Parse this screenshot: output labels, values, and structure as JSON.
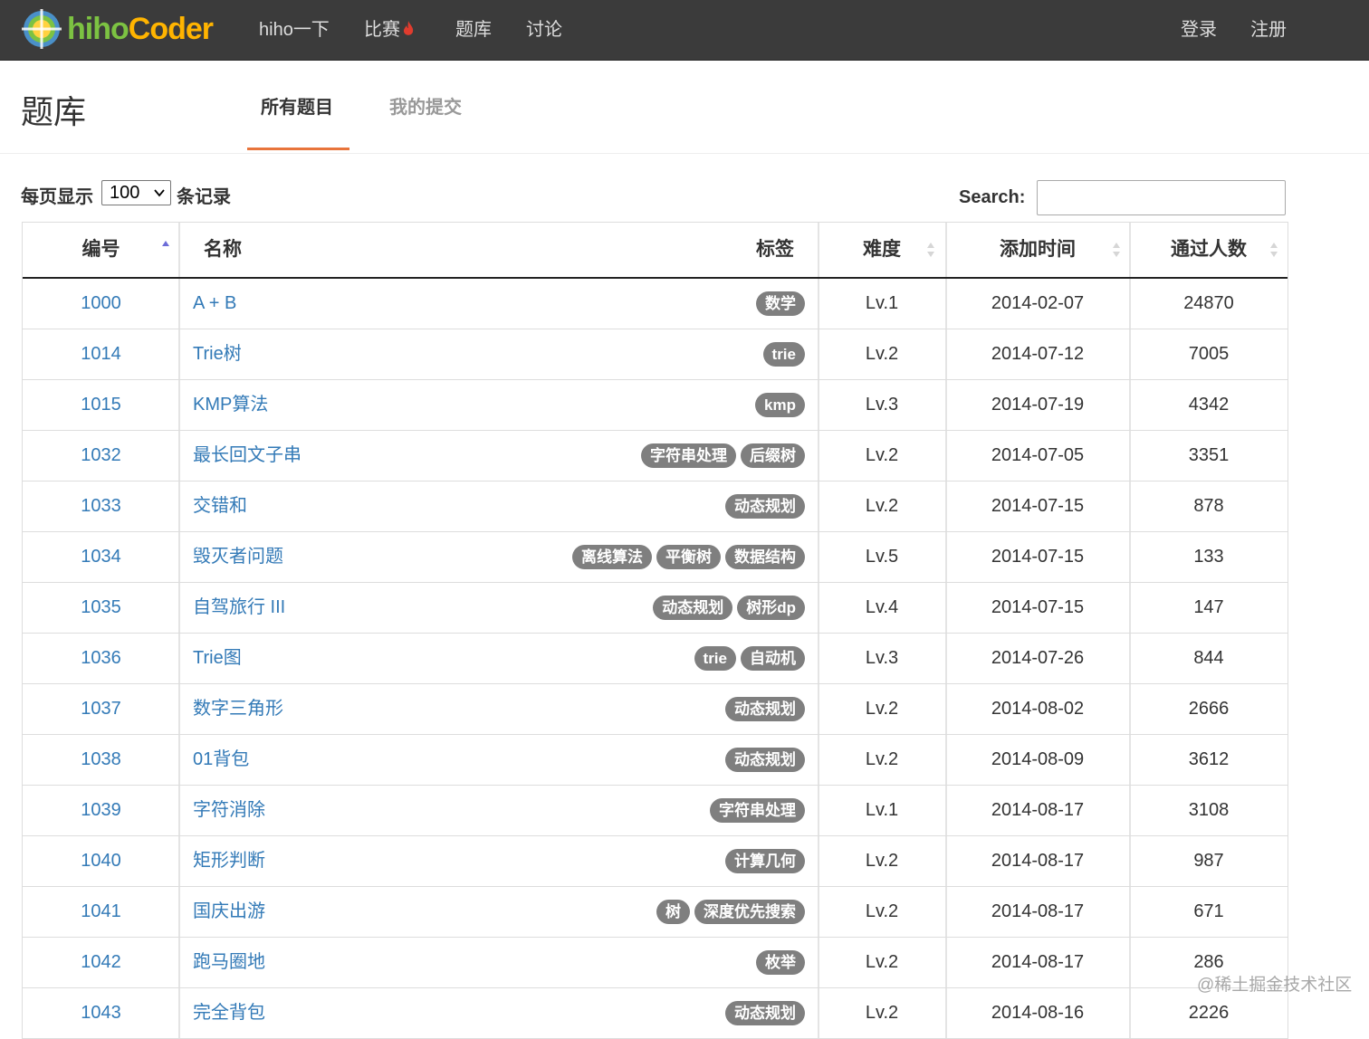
{
  "nav": {
    "logo_hiho": "hiho",
    "logo_coder": "Coder",
    "items": [
      "hiho一下",
      "比赛",
      "题库",
      "讨论"
    ],
    "login": "登录",
    "register": "注册"
  },
  "header": {
    "title": "题库",
    "tab_all": "所有题目",
    "tab_mine": "我的提交"
  },
  "controls": {
    "show_prefix": "每页显示",
    "page_size": "100",
    "show_suffix": "条记录",
    "search_label": "Search:",
    "search_value": ""
  },
  "table": {
    "headers": {
      "id": "编号",
      "name": "名称",
      "tags": "标签",
      "level": "难度",
      "date": "添加时间",
      "passed": "通过人数"
    },
    "rows": [
      {
        "id": "1000",
        "name": "A + B",
        "tags": [
          "数学"
        ],
        "level": "Lv.1",
        "date": "2014-02-07",
        "passed": "24870"
      },
      {
        "id": "1014",
        "name": "Trie树",
        "tags": [
          "trie"
        ],
        "level": "Lv.2",
        "date": "2014-07-12",
        "passed": "7005"
      },
      {
        "id": "1015",
        "name": "KMP算法",
        "tags": [
          "kmp"
        ],
        "level": "Lv.3",
        "date": "2014-07-19",
        "passed": "4342"
      },
      {
        "id": "1032",
        "name": "最长回文子串",
        "tags": [
          "字符串处理",
          "后缀树"
        ],
        "level": "Lv.2",
        "date": "2014-07-05",
        "passed": "3351"
      },
      {
        "id": "1033",
        "name": "交错和",
        "tags": [
          "动态规划"
        ],
        "level": "Lv.2",
        "date": "2014-07-15",
        "passed": "878"
      },
      {
        "id": "1034",
        "name": "毁灭者问题",
        "tags": [
          "离线算法",
          "平衡树",
          "数据结构"
        ],
        "level": "Lv.5",
        "date": "2014-07-15",
        "passed": "133"
      },
      {
        "id": "1035",
        "name": "自驾旅行 III",
        "tags": [
          "动态规划",
          "树形dp"
        ],
        "level": "Lv.4",
        "date": "2014-07-15",
        "passed": "147"
      },
      {
        "id": "1036",
        "name": "Trie图",
        "tags": [
          "trie",
          "自动机"
        ],
        "level": "Lv.3",
        "date": "2014-07-26",
        "passed": "844"
      },
      {
        "id": "1037",
        "name": "数字三角形",
        "tags": [
          "动态规划"
        ],
        "level": "Lv.2",
        "date": "2014-08-02",
        "passed": "2666"
      },
      {
        "id": "1038",
        "name": "01背包",
        "tags": [
          "动态规划"
        ],
        "level": "Lv.2",
        "date": "2014-08-09",
        "passed": "3612"
      },
      {
        "id": "1039",
        "name": "字符消除",
        "tags": [
          "字符串处理"
        ],
        "level": "Lv.1",
        "date": "2014-08-17",
        "passed": "3108"
      },
      {
        "id": "1040",
        "name": "矩形判断",
        "tags": [
          "计算几何"
        ],
        "level": "Lv.2",
        "date": "2014-08-17",
        "passed": "987"
      },
      {
        "id": "1041",
        "name": "国庆出游",
        "tags": [
          "树",
          "深度优先搜索"
        ],
        "level": "Lv.2",
        "date": "2014-08-17",
        "passed": "671"
      },
      {
        "id": "1042",
        "name": "跑马圈地",
        "tags": [
          "枚举"
        ],
        "level": "Lv.2",
        "date": "2014-08-17",
        "passed": "286"
      },
      {
        "id": "1043",
        "name": "完全背包",
        "tags": [
          "动态规划"
        ],
        "level": "Lv.2",
        "date": "2014-08-16",
        "passed": "2226"
      }
    ]
  },
  "watermark": "@稀土掘金技术社区",
  "colors": {
    "nav_bg": "#3b3b3b",
    "link": "#337ab7",
    "tag_bg": "#7f7f7f",
    "tab_underline": "#e8743b",
    "logo_green": "#7cc242",
    "logo_orange": "#ffb400"
  }
}
